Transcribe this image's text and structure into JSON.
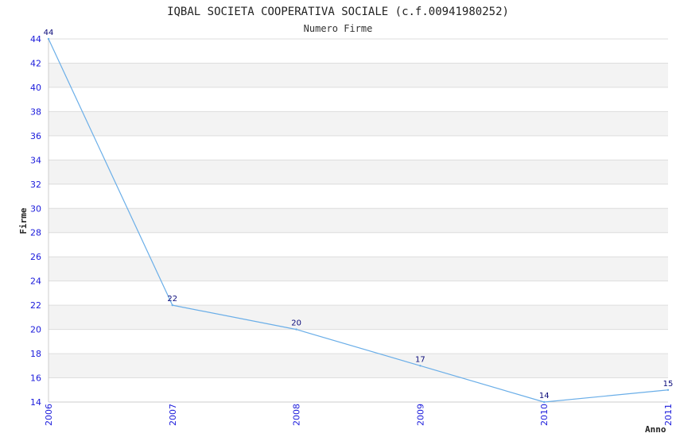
{
  "chart_data": {
    "type": "line",
    "title": "IQBAL SOCIETA COOPERATIVA SOCIALE (c.f.00941980252)",
    "subtitle": "Numero Firme",
    "xlabel": "Anno",
    "ylabel": "Firme",
    "x": [
      "2006",
      "2007",
      "2008",
      "2009",
      "2010",
      "2011"
    ],
    "series": [
      {
        "values": [
          44,
          22,
          20,
          17,
          14,
          15
        ]
      }
    ],
    "data_labels": [
      "44",
      "22",
      "20",
      "17",
      "14",
      "15"
    ],
    "ylim": [
      14,
      44
    ],
    "y_ticks": [
      14,
      16,
      18,
      20,
      22,
      24,
      26,
      28,
      30,
      32,
      34,
      36,
      38,
      40,
      42,
      44
    ],
    "grid": true,
    "line_color": "#6aaee8",
    "tick_color": "#1a1adb",
    "band_color": "#f3f3f3"
  }
}
